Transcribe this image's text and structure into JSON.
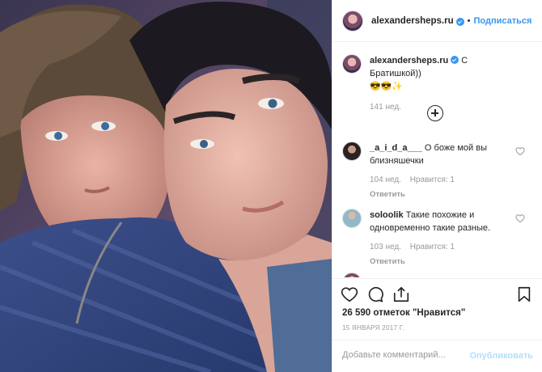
{
  "post": {
    "username": "alexandersheps.ru",
    "follow_label": "Подписаться",
    "dot": "•"
  },
  "caption": {
    "username": "alexandersheps.ru",
    "text": "С Братишкой))",
    "emoji": "😎😎✨",
    "age": "141 нед."
  },
  "comments": [
    {
      "username": "_a_i_d_a___",
      "text": "О боже мой вы близняшечки",
      "age": "104 нед.",
      "likes": "Нравится: 1",
      "reply": "Ответить"
    },
    {
      "username": "soloolik",
      "text": "Такие похожие и одновременно такие разные.",
      "age": "103 нед.",
      "likes": "Нравится: 1",
      "reply": "Ответить"
    }
  ],
  "stats": {
    "likes": "26 590 отметок \"Нравится\"",
    "date": "15 ЯНВАРЯ 2017 Г."
  },
  "add_comment": {
    "placeholder": "Добавьте комментарий...",
    "publish": "Опубликовать"
  },
  "icons": [
    "heart-icon",
    "comment-icon",
    "share-icon",
    "bookmark-icon",
    "add-comments-icon",
    "verified-icon"
  ],
  "colors": {
    "link": "#3897f0",
    "muted": "#999999",
    "publish_disabled": "#b2dffc"
  }
}
